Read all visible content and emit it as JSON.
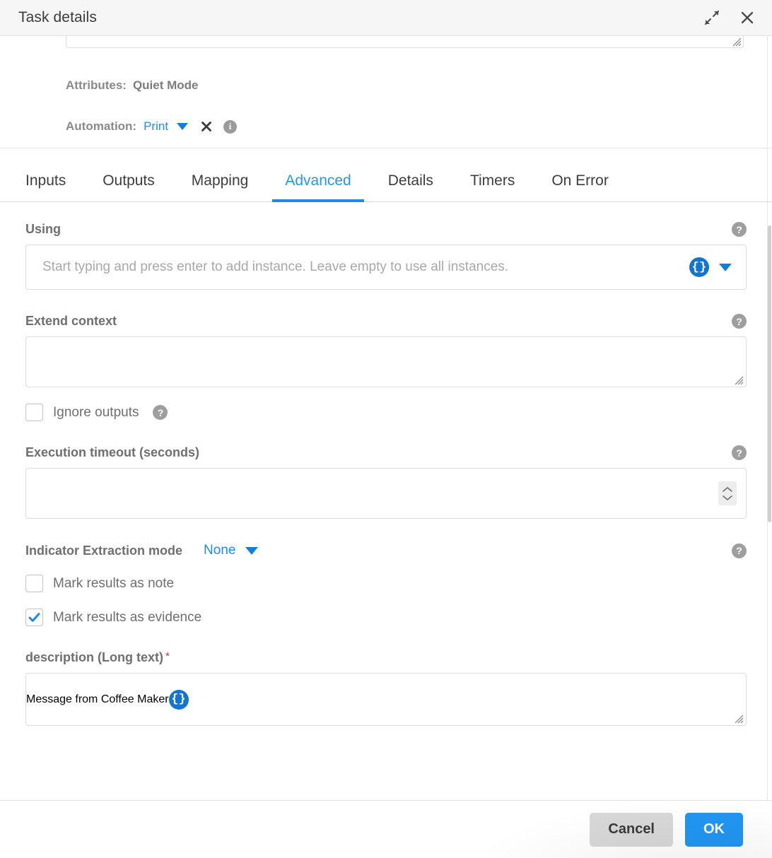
{
  "titlebar": {
    "title": "Task details",
    "expand_icon": "expand-diagonal-icon",
    "close_icon": "close-icon"
  },
  "upper": {
    "attributes_label": "Attributes:",
    "attributes_value": "Quiet Mode",
    "automation_label": "Automation:",
    "automation_value": "Print",
    "automation_clear_icon": "clear-x-icon",
    "automation_info_icon": "info-icon"
  },
  "tabs": [
    {
      "label": "Inputs",
      "active": false
    },
    {
      "label": "Outputs",
      "active": false
    },
    {
      "label": "Mapping",
      "active": false
    },
    {
      "label": "Advanced",
      "active": true
    },
    {
      "label": "Details",
      "active": false
    },
    {
      "label": "Timers",
      "active": false
    },
    {
      "label": "On Error",
      "active": false
    }
  ],
  "form": {
    "using": {
      "label": "Using",
      "placeholder": "Start typing and press enter to add instance. Leave empty to use all instances.",
      "value": "",
      "help_icon": "help-icon",
      "brace_icon": "curly-braces-icon",
      "caret_icon": "chevron-down-icon"
    },
    "extend_context": {
      "label": "Extend context",
      "value": "",
      "help_icon": "help-icon",
      "resize_icon": "resize-handle-icon"
    },
    "ignore_outputs": {
      "label": "Ignore outputs",
      "checked": false,
      "help_icon": "help-icon"
    },
    "execution_timeout": {
      "label": "Execution timeout (seconds)",
      "value": "",
      "help_icon": "help-icon",
      "stepper_icon": "spinner-stepper-icon"
    },
    "indicator_extraction": {
      "label": "Indicator Extraction mode",
      "value": "None",
      "options": [
        "None"
      ],
      "help_icon": "help-icon",
      "caret_icon": "chevron-down-icon"
    },
    "mark_note": {
      "label": "Mark results as note",
      "checked": false
    },
    "mark_evidence": {
      "label": "Mark results as evidence",
      "checked": true
    },
    "description": {
      "label": "description (Long text)",
      "required_marker": "*",
      "value": "Message from Coffee Maker",
      "brace_icon": "curly-braces-icon",
      "resize_icon": "resize-handle-icon"
    }
  },
  "footer": {
    "cancel_label": "Cancel",
    "ok_label": "OK"
  },
  "colors": {
    "accent_blue": "#2196f3",
    "link_blue": "#1a8cff",
    "brace_blue": "#1275d1",
    "required_red": "#d32f2f",
    "titlebar_bg": "#f6f6f6"
  }
}
